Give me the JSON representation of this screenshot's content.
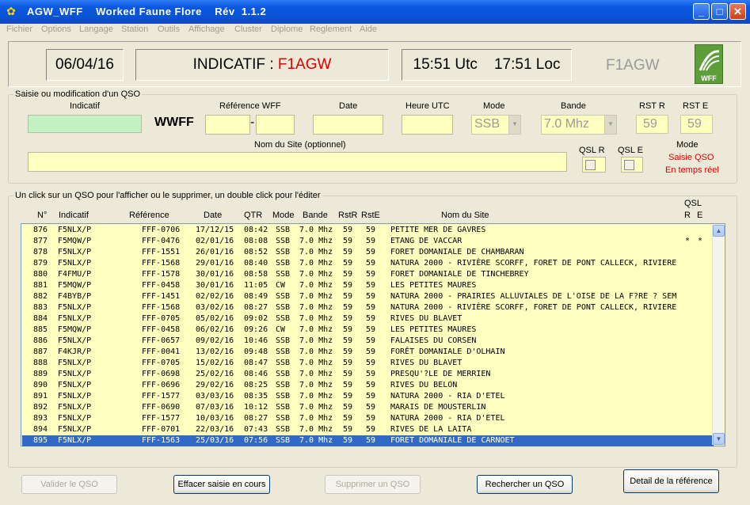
{
  "window": {
    "title": "AGW_WFF    Worked Faune Flore    Rév  1.1.2"
  },
  "menu": [
    "Fichier",
    "Options",
    "Langage",
    "Station",
    "Outils",
    "Affichage",
    "Cluster",
    "Diplome",
    "Reglement",
    "Aide"
  ],
  "header": {
    "date": "06/04/16",
    "indicatif_label": "INDICATIF : ",
    "indicatif_value": "F1AGW",
    "utc_time": "15:51 Utc",
    "local_time": "17:51 Loc",
    "callsign_grey": "F1AGW",
    "logo_text": "WFF",
    "accent_red": "#E00000"
  },
  "entry": {
    "group_title": "Saisie ou modification d'un QSO",
    "indicatif_label": "Indicatif",
    "wwff_label": "WWFF",
    "ref_label": "Référence WFF",
    "ref_dash": "-",
    "date_label": "Date",
    "heure_label": "Heure UTC",
    "mode_label": "Mode",
    "mode_value": "SSB",
    "bande_label": "Bande",
    "bande_value": "7.0 Mhz",
    "rstr_label": "RST R",
    "rstr_value": "59",
    "rste_label": "RST E",
    "rste_value": "59",
    "site_label": "Nom du Site (optionnel)",
    "qslr_label": "QSL R",
    "qsle_label": "QSL E",
    "mode_title": "Mode",
    "mode_line1": "Saisie QSO",
    "mode_line2": "En temps réel"
  },
  "list": {
    "group_title": "Un click sur un QSO pour l'afficher ou le supprimer, un double click pour l'éditer",
    "headers": {
      "n": "N°",
      "indicatif": "Indicatif",
      "reference": "Référence",
      "date": "Date",
      "qtr": "QTR",
      "mode": "Mode",
      "bande": "Bande",
      "rstr": "RstR",
      "rste": "RstE",
      "site": "Nom du Site",
      "qsl": "QSL",
      "qsl_r": "R",
      "qsl_e": "E"
    },
    "rows": [
      {
        "n": "876",
        "call": "F5NLX/P",
        "ref": "FFF-0706",
        "date": "17/12/15",
        "qtr": "08:42",
        "mode": "SSB",
        "band": "7.0 Mhz",
        "rstr": "59",
        "rste": "59",
        "site": "PETITE MER DE GAVRES",
        "qr": "",
        "qe": ""
      },
      {
        "n": "877",
        "call": "F5MQW/P",
        "ref": "FFF-0476",
        "date": "02/01/16",
        "qtr": "08:08",
        "mode": "SSB",
        "band": "7.0 Mhz",
        "rstr": "59",
        "rste": "59",
        "site": "ETANG DE VACCAR",
        "qr": "*",
        "qe": "*"
      },
      {
        "n": "878",
        "call": "F5NLX/P",
        "ref": "FFF-1551",
        "date": "26/01/16",
        "qtr": "08:52",
        "mode": "SSB",
        "band": "7.0 Mhz",
        "rstr": "59",
        "rste": "59",
        "site": "FORET DOMANIALE DE CHAMBARAN",
        "qr": "",
        "qe": ""
      },
      {
        "n": "879",
        "call": "F5NLX/P",
        "ref": "FFF-1568",
        "date": "29/01/16",
        "qtr": "08:40",
        "mode": "SSB",
        "band": "7.0 Mhz",
        "rstr": "59",
        "rste": "59",
        "site": "NATURA 2000 - RIVIÈRE SCORFF, FORET DE PONT CALLECK, RIVIERE",
        "qr": "",
        "qe": ""
      },
      {
        "n": "880",
        "call": "F4FMU/P",
        "ref": "FFF-1578",
        "date": "30/01/16",
        "qtr": "08:58",
        "mode": "SSB",
        "band": "7.0 Mhz",
        "rstr": "59",
        "rste": "59",
        "site": "FORET DOMANIALE DE TINCHEBREY",
        "qr": "",
        "qe": ""
      },
      {
        "n": "881",
        "call": "F5MQW/P",
        "ref": "FFF-0458",
        "date": "30/01/16",
        "qtr": "11:05",
        "mode": "CW",
        "band": "7.0 Mhz",
        "rstr": "59",
        "rste": "59",
        "site": "LES PETITES MAURES",
        "qr": "",
        "qe": ""
      },
      {
        "n": "882",
        "call": "F4BYB/P",
        "ref": "FFF-1451",
        "date": "02/02/16",
        "qtr": "08:49",
        "mode": "SSB",
        "band": "7.0 Mhz",
        "rstr": "59",
        "rste": "59",
        "site": "NATURA 2000 - PRAIRIES ALLUVIALES DE L'OISE DE LA F?RE ? SEM",
        "qr": "",
        "qe": ""
      },
      {
        "n": "883",
        "call": "F5NLX/P",
        "ref": "FFF-1568",
        "date": "03/02/16",
        "qtr": "08:27",
        "mode": "SSB",
        "band": "7.0 Mhz",
        "rstr": "59",
        "rste": "59",
        "site": "NATURA 2000 - RIVIÈRE SCORFF, FORET DE PONT CALLECK, RIVIERE",
        "qr": "",
        "qe": ""
      },
      {
        "n": "884",
        "call": "F5NLX/P",
        "ref": "FFF-0705",
        "date": "05/02/16",
        "qtr": "09:02",
        "mode": "SSB",
        "band": "7.0 Mhz",
        "rstr": "59",
        "rste": "59",
        "site": "RIVES DU BLAVET",
        "qr": "",
        "qe": ""
      },
      {
        "n": "885",
        "call": "F5MQW/P",
        "ref": "FFF-0458",
        "date": "06/02/16",
        "qtr": "09:26",
        "mode": "CW",
        "band": "7.0 Mhz",
        "rstr": "59",
        "rste": "59",
        "site": "LES PETITES MAURES",
        "qr": "",
        "qe": ""
      },
      {
        "n": "886",
        "call": "F5NLX/P",
        "ref": "FFF-0657",
        "date": "09/02/16",
        "qtr": "10:46",
        "mode": "SSB",
        "band": "7.0 Mhz",
        "rstr": "59",
        "rste": "59",
        "site": "FALAISES DU CORSEN",
        "qr": "",
        "qe": ""
      },
      {
        "n": "887",
        "call": "F4KJR/P",
        "ref": "FFF-0041",
        "date": "13/02/16",
        "qtr": "09:48",
        "mode": "SSB",
        "band": "7.0 Mhz",
        "rstr": "59",
        "rste": "59",
        "site": "FORÊT DOMANIALE D'OLHAIN",
        "qr": "",
        "qe": ""
      },
      {
        "n": "888",
        "call": "F5NLX/P",
        "ref": "FFF-0705",
        "date": "15/02/16",
        "qtr": "08:47",
        "mode": "SSB",
        "band": "7.0 Mhz",
        "rstr": "59",
        "rste": "59",
        "site": "RIVES DU BLAVET",
        "qr": "",
        "qe": ""
      },
      {
        "n": "889",
        "call": "F5NLX/P",
        "ref": "FFF-0698",
        "date": "25/02/16",
        "qtr": "08:46",
        "mode": "SSB",
        "band": "7.0 Mhz",
        "rstr": "59",
        "rste": "59",
        "site": "PRESQU'?LE DE MERRIEN",
        "qr": "",
        "qe": ""
      },
      {
        "n": "890",
        "call": "F5NLX/P",
        "ref": "FFF-0696",
        "date": "29/02/16",
        "qtr": "08:25",
        "mode": "SSB",
        "band": "7.0 Mhz",
        "rstr": "59",
        "rste": "59",
        "site": "RIVES DU BELON",
        "qr": "",
        "qe": ""
      },
      {
        "n": "891",
        "call": "F5NLX/P",
        "ref": "FFF-1577",
        "date": "03/03/16",
        "qtr": "08:35",
        "mode": "SSB",
        "band": "7.0 Mhz",
        "rstr": "59",
        "rste": "59",
        "site": "NATURA 2000 - RIA D'ETEL",
        "qr": "",
        "qe": ""
      },
      {
        "n": "892",
        "call": "F5NLX/P",
        "ref": "FFF-0690",
        "date": "07/03/16",
        "qtr": "10:12",
        "mode": "SSB",
        "band": "7.0 Mhz",
        "rstr": "59",
        "rste": "59",
        "site": "MARAIS DE MOUSTERLIN",
        "qr": "",
        "qe": ""
      },
      {
        "n": "893",
        "call": "F5NLX/P",
        "ref": "FFF-1577",
        "date": "10/03/16",
        "qtr": "08:27",
        "mode": "SSB",
        "band": "7.0 Mhz",
        "rstr": "59",
        "rste": "59",
        "site": "NATURA 2000 - RIA D'ETEL",
        "qr": "",
        "qe": ""
      },
      {
        "n": "894",
        "call": "F5NLX/P",
        "ref": "FFF-0701",
        "date": "22/03/16",
        "qtr": "07:43",
        "mode": "SSB",
        "band": "7.0 Mhz",
        "rstr": "59",
        "rste": "59",
        "site": "RIVES DE LA LAITA",
        "qr": "",
        "qe": ""
      },
      {
        "n": "895",
        "call": "F5NLX/P",
        "ref": "FFF-1563",
        "date": "25/03/16",
        "qtr": "07:56",
        "mode": "SSB",
        "band": "7.0 Mhz",
        "rstr": "59",
        "rste": "59",
        "site": "FORET DOMANIALE DE CARNOET",
        "qr": "",
        "qe": "",
        "selected": true
      }
    ]
  },
  "buttons": {
    "valider": "Valider le QSO",
    "effacer": "Effacer saisie en cours",
    "supprimer": "Supprimer un QSO",
    "rechercher": "Rechercher un QSO",
    "detail": "Detail de la référence"
  },
  "icons": {
    "app": "butterfly-icon",
    "logo": "wff-logo-icon",
    "minimize": "minimize-icon",
    "maximize": "maximize-icon",
    "close": "close-icon",
    "scroll_up": "chevron-up-icon",
    "scroll_down": "chevron-down-icon"
  }
}
